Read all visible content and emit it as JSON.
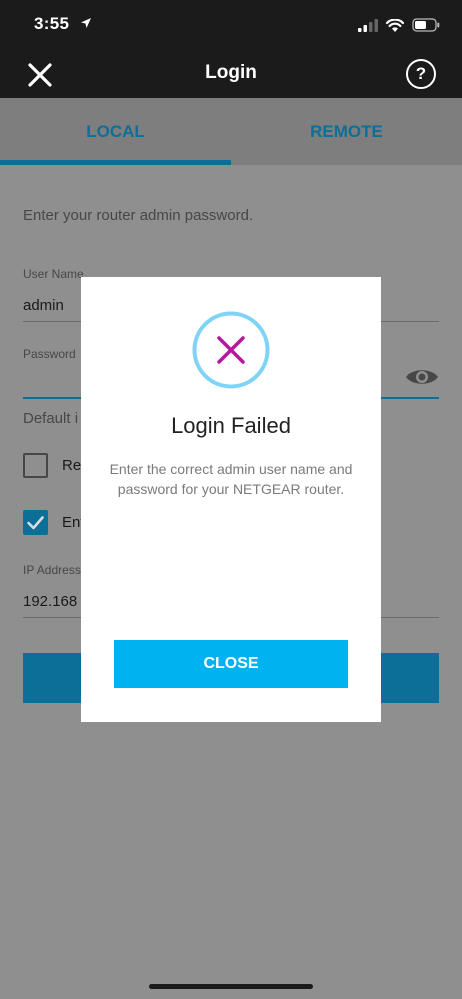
{
  "status_bar": {
    "time": "3:55",
    "icons": [
      "location-arrow-icon",
      "cellular-signal-icon",
      "wifi-icon",
      "battery-icon"
    ]
  },
  "nav": {
    "title": "Login",
    "close_icon": "close-icon",
    "help_symbol": "?"
  },
  "tabs": [
    {
      "label": "LOCAL",
      "selected": true
    },
    {
      "label": "REMOTE",
      "selected": false
    }
  ],
  "form": {
    "intro": "Enter your router admin password.",
    "username_label": "User Name",
    "username_value": "admin",
    "password_label": "Password",
    "default_text": "Default i",
    "checkbox1_label": "Re",
    "checkbox1_checked": false,
    "checkbox2_label": "Ent",
    "checkbox2_checked": true,
    "ip_label": "IP Address",
    "ip_value": "192.168"
  },
  "dialog": {
    "title": "Login Failed",
    "message": "Enter the correct admin user name and password for your NETGEAR router.",
    "close_label": "CLOSE",
    "icon": "error-x-icon"
  },
  "colors": {
    "accent_blue": "#00b2ef",
    "error_magenta": "#b5179e",
    "icon_ring": "#7fd3f7"
  }
}
